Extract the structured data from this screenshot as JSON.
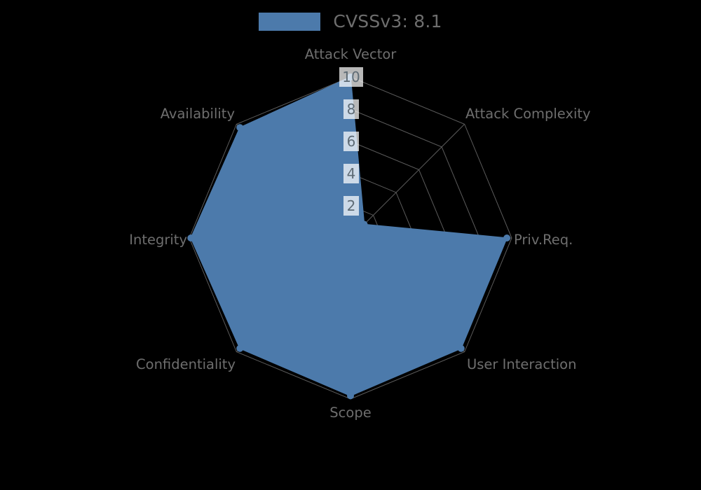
{
  "legend": {
    "label": "CVSSv3: 8.1",
    "swatch_color": "#4c7aab"
  },
  "colors": {
    "background": "#000000",
    "series": "#4c7aab",
    "grid": "#5b5b5b",
    "label_text": "#6e6e6e",
    "tick_text": "#5e6b75"
  },
  "axis_labels": {
    "attack_vector": "Attack Vector",
    "attack_complexity": "Attack Complexity",
    "priv_req": "Priv.Req.",
    "user_interaction": "User Interaction",
    "scope": "Scope",
    "confidentiality": "Confidentiality",
    "integrity": "Integrity",
    "availability": "Availability"
  },
  "ticks": {
    "t2": "2",
    "t4": "4",
    "t6": "6",
    "t8": "8",
    "t10": "10"
  },
  "chart_data": {
    "type": "radar",
    "title": "",
    "subtitle": "",
    "xlabel": "",
    "ylabel": "",
    "categories": [
      "Attack Vector",
      "Attack Complexity",
      "Priv.Req.",
      "User Interaction",
      "Scope",
      "Confidentiality",
      "Integrity",
      "Availability"
    ],
    "series": [
      {
        "name": "CVSSv3: 8.1",
        "color": "#4c7aab",
        "values": [
          10.0,
          1.2,
          9.7,
          9.7,
          9.8,
          9.7,
          9.9,
          9.7
        ]
      }
    ],
    "rlim": [
      0,
      10
    ],
    "rticks": [
      2,
      4,
      6,
      8,
      10
    ],
    "grid": true,
    "legend_position": "top-center",
    "start_angle_deg": 90,
    "direction": "clockwise"
  }
}
